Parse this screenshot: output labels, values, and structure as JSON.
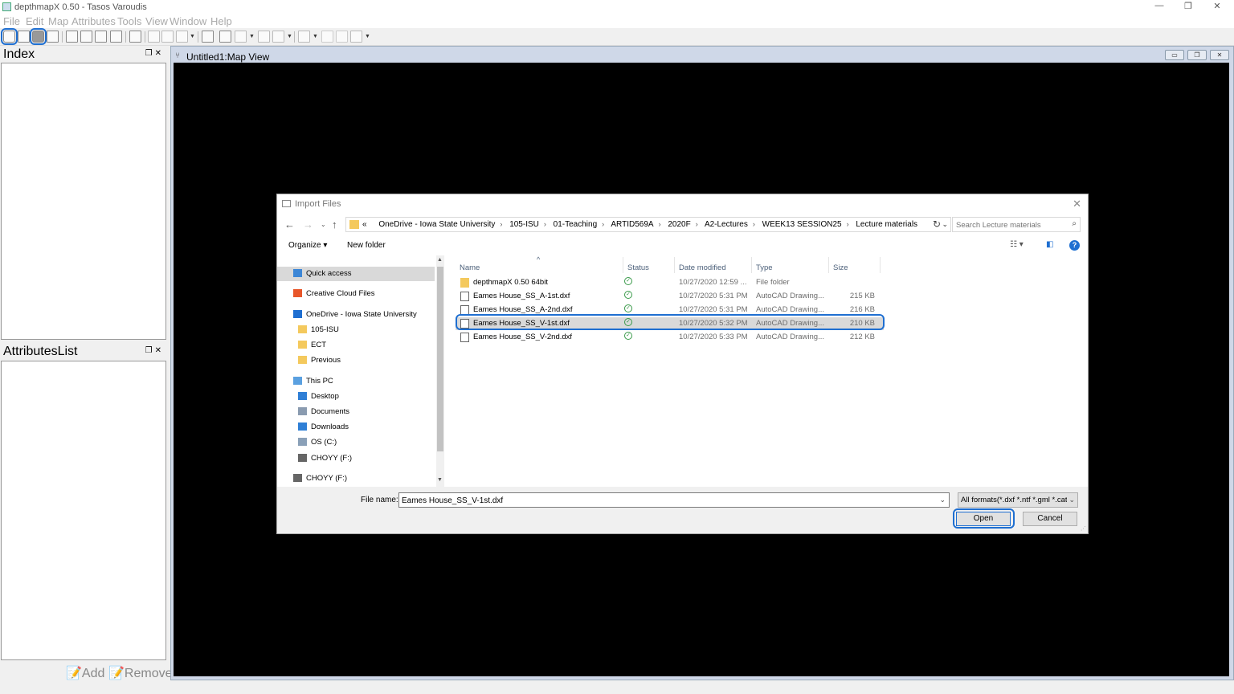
{
  "app": {
    "title": "depthmapX 0.50 - Tasos Varoudis",
    "window_controls": [
      "—",
      "❐",
      "✕"
    ]
  },
  "menu": [
    "File",
    "Edit",
    "Map",
    "Attributes",
    "Tools",
    "View",
    "Window",
    "Help"
  ],
  "docks": {
    "index": {
      "title": "Index"
    },
    "attributes": {
      "title": "AttributesList"
    },
    "add_label": "Add",
    "remove_label": "Remove"
  },
  "mapview": {
    "title": "Untitled1:Map View"
  },
  "dialog": {
    "title": "Import Files",
    "address": [
      "OneDrive - Iowa State University",
      "105-ISU",
      "01-Teaching",
      "ARTID569A",
      "2020F",
      "A2-Lectures",
      "WEEK13 SESSION25",
      "Lecture materials"
    ],
    "address_prefix": "«",
    "search_placeholder": "Search Lecture materials",
    "organize_label": "Organize ▾",
    "new_folder_label": "New folder",
    "nav": [
      {
        "label": "Quick access",
        "icon": "star-icon",
        "indent": 0,
        "selected": true
      },
      {
        "label": "Creative Cloud Files",
        "icon": "creative-cloud-icon",
        "indent": 0
      },
      {
        "label": "OneDrive - Iowa State University",
        "icon": "onedrive-icon",
        "indent": 0
      },
      {
        "label": "105-ISU",
        "icon": "folder-icon",
        "indent": 1
      },
      {
        "label": "ECT",
        "icon": "folder-icon",
        "indent": 1
      },
      {
        "label": "Previous",
        "icon": "folder-icon",
        "indent": 1
      },
      {
        "label": "This PC",
        "icon": "computer-icon",
        "indent": 0
      },
      {
        "label": "Desktop",
        "icon": "desktop-icon",
        "indent": 1
      },
      {
        "label": "Documents",
        "icon": "documents-icon",
        "indent": 1
      },
      {
        "label": "Downloads",
        "icon": "downloads-icon",
        "indent": 1
      },
      {
        "label": "OS (C:)",
        "icon": "drive-icon",
        "indent": 1
      },
      {
        "label": "CHOYY (F:)",
        "icon": "usb-drive-icon",
        "indent": 1
      },
      {
        "label": "CHOYY (F:)",
        "icon": "usb-drive-icon",
        "indent": 0
      }
    ],
    "columns": [
      "Name",
      "Status",
      "Date modified",
      "Type",
      "Size"
    ],
    "files": [
      {
        "name": "depthmapX 0.50 64bit",
        "icon": "folder-icon",
        "date": "10/27/2020 12:59 ...",
        "type": "File folder",
        "size": ""
      },
      {
        "name": "Eames House_SS_A-1st.dxf",
        "icon": "dxf-file-icon",
        "date": "10/27/2020 5:31 PM",
        "type": "AutoCAD Drawing...",
        "size": "215 KB"
      },
      {
        "name": "Eames House_SS_A-2nd.dxf",
        "icon": "dxf-file-icon",
        "date": "10/27/2020 5:31 PM",
        "type": "AutoCAD Drawing...",
        "size": "216 KB"
      },
      {
        "name": "Eames House_SS_V-1st.dxf",
        "icon": "dxf-file-icon",
        "date": "10/27/2020 5:32 PM",
        "type": "AutoCAD Drawing...",
        "size": "210 KB",
        "selected": true
      },
      {
        "name": "Eames House_SS_V-2nd.dxf",
        "icon": "dxf-file-icon",
        "date": "10/27/2020 5:33 PM",
        "type": "AutoCAD Drawing...",
        "size": "212 KB"
      }
    ],
    "filename_label": "File name:",
    "filename_value": "Eames House_SS_V-1st.dxf",
    "filter_value": "All formats(*.dxf *.ntf *.gml *.cat",
    "open_label": "Open",
    "cancel_label": "Cancel"
  },
  "colors": {
    "highlight": "#1f6fd1",
    "selection": "#d9d9d9",
    "canvas": "#000000"
  }
}
